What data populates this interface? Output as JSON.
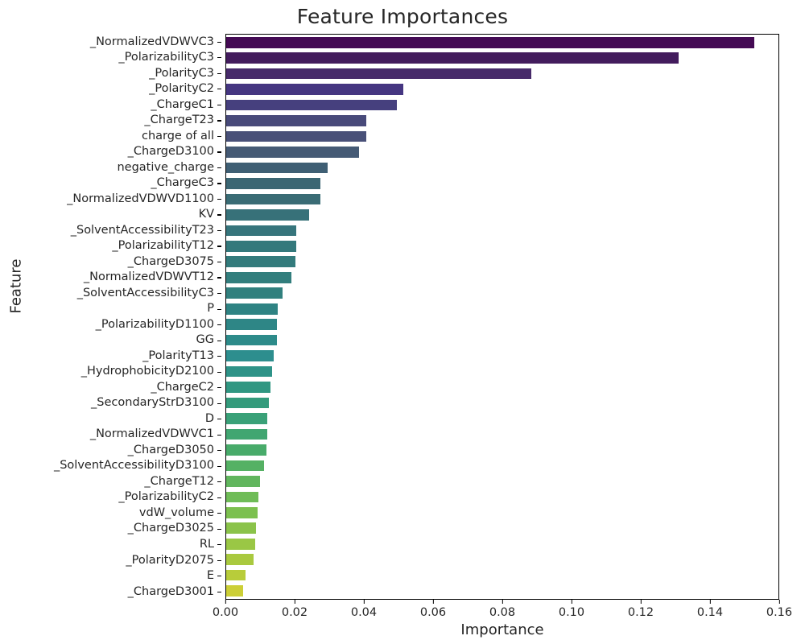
{
  "chart_data": {
    "type": "bar",
    "orientation": "horizontal",
    "title": "Feature Importances",
    "xlabel": "Importance",
    "ylabel": "Feature",
    "xlim": [
      0.0,
      0.16
    ],
    "ylim_note": "categorical, 35 features sorted descending",
    "grid": false,
    "legend": null,
    "colormap": "viridis",
    "xticks": [
      "0.00",
      "0.02",
      "0.04",
      "0.06",
      "0.08",
      "0.10",
      "0.12",
      "0.14",
      "0.16"
    ],
    "xtick_values": [
      0.0,
      0.02,
      0.04,
      0.06,
      0.08,
      0.1,
      0.12,
      0.14,
      0.16
    ],
    "categories": [
      "_NormalizedVDWVC3",
      "_PolarizabilityC3",
      "_PolarityC3",
      "_PolarityC2",
      "_ChargeC1",
      "_ChargeT23",
      "charge of all",
      "_ChargeD3100",
      "negative_charge",
      "_ChargeC3",
      "_NormalizedVDWVD1100",
      "KV",
      "_SolventAccessibilityT23",
      "_PolarizabilityT12",
      "_ChargeD3075",
      "_NormalizedVDWVT12",
      "_SolventAccessibilityC3",
      "P",
      "_PolarizabilityD1100",
      "GG",
      "_PolarityT13",
      "_HydrophobicityD2100",
      "_ChargeC2",
      "_SecondaryStrD3100",
      "D",
      "_NormalizedVDWVC1",
      "_ChargeD3050",
      "_SolventAccessibilityD3100",
      "_ChargeT12",
      "_PolarizabilityC2",
      "vdW_volume",
      "_ChargeD3025",
      "RL",
      "_PolarityD2075",
      "E",
      "_ChargeD3001"
    ],
    "values": [
      0.153,
      0.131,
      0.0884,
      0.0512,
      0.0495,
      0.0405,
      0.0405,
      0.0386,
      0.0293,
      0.0274,
      0.0274,
      0.024,
      0.0202,
      0.0202,
      0.02,
      0.0188,
      0.0163,
      0.015,
      0.0147,
      0.0147,
      0.0137,
      0.0133,
      0.0128,
      0.0123,
      0.012,
      0.0118,
      0.0116,
      0.011,
      0.0098,
      0.0093,
      0.009,
      0.0087,
      0.0083,
      0.008,
      0.0055,
      0.005
    ],
    "colors": [
      "#440a54",
      "#431c5d",
      "#472a6a",
      "#453681",
      "#46407e",
      "#484a7a",
      "#485078",
      "#455a75",
      "#3f5f74",
      "#3b6673",
      "#3a6c75",
      "#377179",
      "#36757c",
      "#34797c",
      "#337b7c",
      "#327e7d",
      "#31807e",
      "#2f8383",
      "#2e8686",
      "#2d8b8a",
      "#2d8e8e",
      "#2e9388",
      "#309782",
      "#349b7c",
      "#3aa178",
      "#41a671",
      "#48ab6a",
      "#55b164",
      "#61b65e",
      "#6fbc57",
      "#7cc04f",
      "#8bc34a",
      "#9ac745",
      "#a9c93f",
      "#b8cc3a",
      "#cccf36"
    ]
  }
}
